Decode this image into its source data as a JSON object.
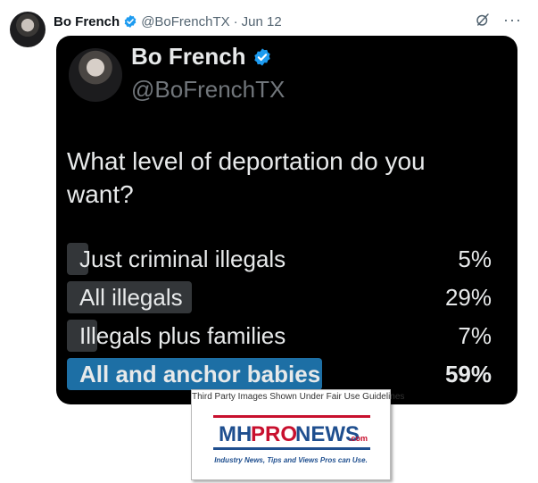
{
  "tweet": {
    "author_name": "Bo French",
    "author_handle": "@BoFrenchTX",
    "separator": "·",
    "date": "Jun 12",
    "verified_color": "#1d9bf0",
    "icons": {
      "grok": "grok-icon",
      "more": "more-icon"
    },
    "more_glyph": "···"
  },
  "card": {
    "author_name": "Bo French",
    "author_handle": "@BoFrenchTX",
    "question": "What level of deportation do you want?",
    "poll": [
      {
        "label": "Just criminal illegals",
        "percent_text": "5%",
        "percent": 5,
        "winner": false
      },
      {
        "label": "All illegals",
        "percent_text": "29%",
        "percent": 29,
        "winner": false
      },
      {
        "label": "Illegals plus families",
        "percent_text": "7%",
        "percent": 7,
        "winner": false
      },
      {
        "label": "All and anchor babies",
        "percent_text": "59%",
        "percent": 59,
        "winner": true
      }
    ],
    "winner_color": "#1d6fa5",
    "bar_color": "#333639"
  },
  "watermark": {
    "caption": "Third Party Images Shown Under Fair Use Guidelines",
    "logo_text_mh": "MH",
    "logo_text_pro": "PRO",
    "logo_text_news": "NEWS",
    "logo_text_com": ".com",
    "tagline": "Industry News, Tips and Views Pros can Use."
  }
}
